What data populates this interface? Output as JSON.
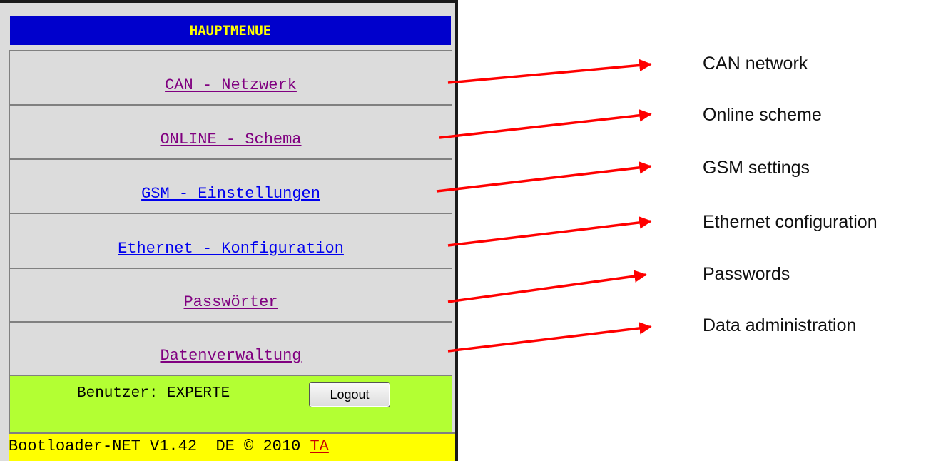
{
  "menu": {
    "title": "HAUPTMENUE",
    "items": [
      {
        "label": "CAN - Netzwerk",
        "visited": true
      },
      {
        "label": "ONLINE - Schema",
        "visited": true
      },
      {
        "label": "GSM - Einstellungen",
        "visited": false
      },
      {
        "label": "Ethernet - Konfiguration",
        "visited": false
      },
      {
        "label": "Passwörter",
        "visited": true
      },
      {
        "label": "Datenverwaltung",
        "visited": true
      }
    ]
  },
  "user": {
    "text": "Benutzer: EXPERTE",
    "logout_label": "Logout"
  },
  "footer": {
    "text": "Bootloader-NET V1.42  DE © 2010 ",
    "link": "TA"
  },
  "annotations": [
    "CAN network",
    "Online scheme",
    "GSM settings",
    "Ethernet configuration",
    "Passwords",
    "Data administration"
  ],
  "colors": {
    "title_bg": "#0000cc",
    "title_text": "#ffff00",
    "user_bar_bg": "#b3ff33",
    "footer_bg": "#ffff00",
    "arrow": "#ff0000",
    "visited_link": "#800080",
    "unvisited_link": "#0000ee"
  }
}
